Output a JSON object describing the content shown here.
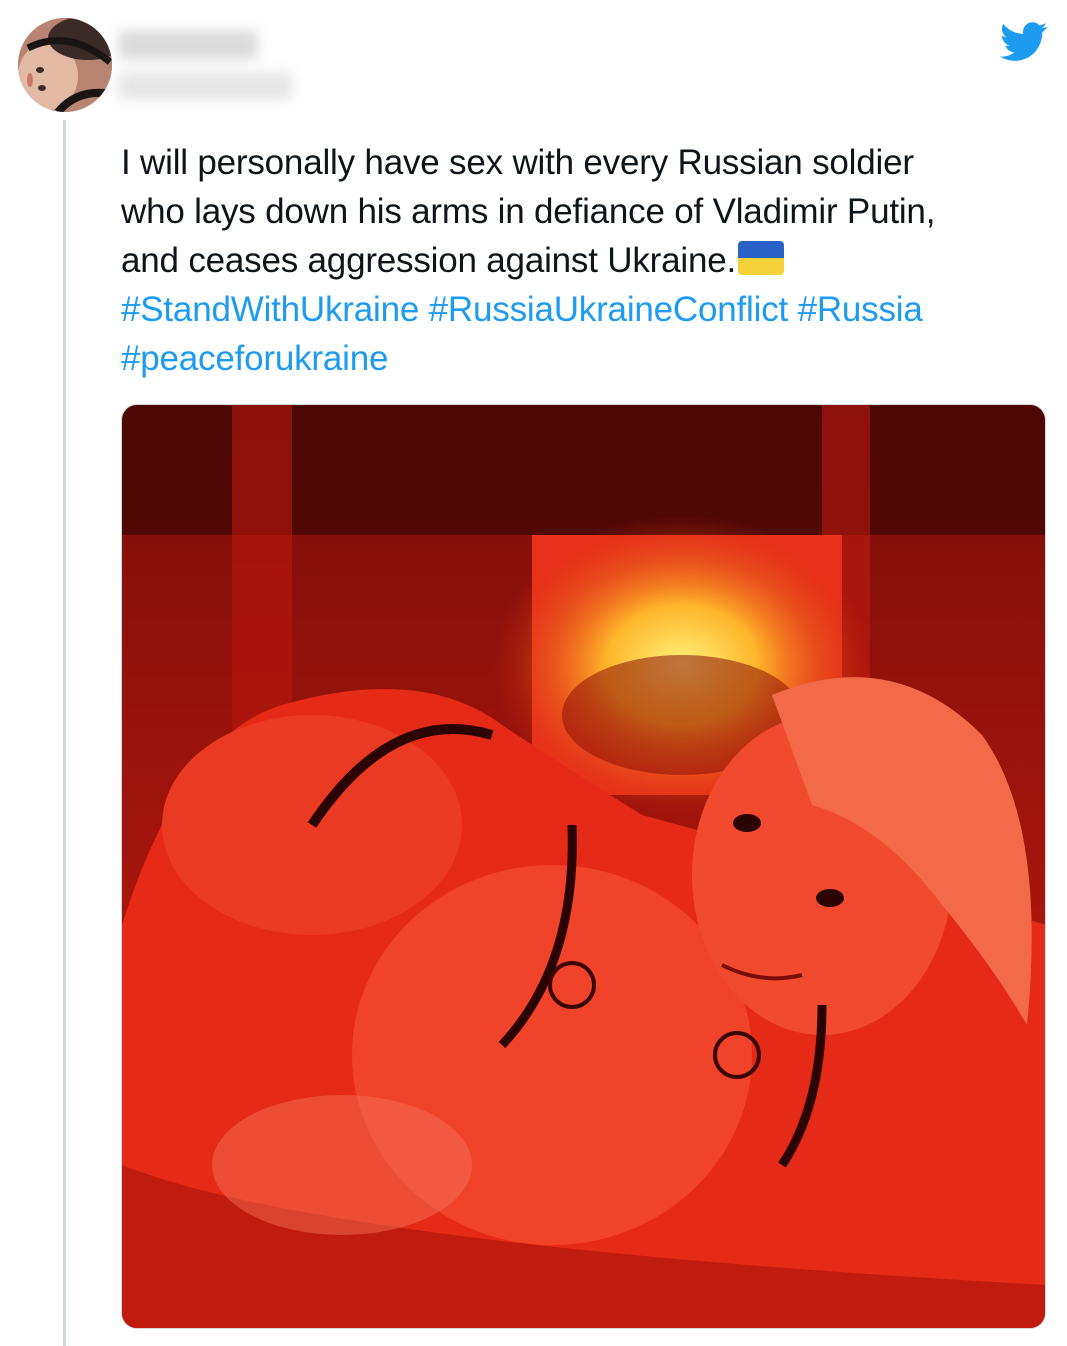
{
  "tweet": {
    "author_name": "",
    "author_handle": "",
    "text_lines": [
      "I will personally have sex with every Russian soldier",
      "who lays down his arms in defiance of Vladimir Putin,",
      "and ceases aggression against Ukraine."
    ],
    "flag_icon": "ukraine-flag-icon",
    "hashtags_line1": [
      "#StandWithUkraine",
      "#RussiaUkraineConflict",
      "#Russia"
    ],
    "hashtags_line2": [
      "#peaceforukraine"
    ]
  },
  "icons": {
    "brand": "twitter-bird-icon"
  },
  "colors": {
    "text": "#0f1419",
    "hashtag": "#1d9bf0",
    "twitter_blue": "#1d9bf0",
    "thread_line": "#cfd9de",
    "photo_tint": "#e8281a"
  }
}
